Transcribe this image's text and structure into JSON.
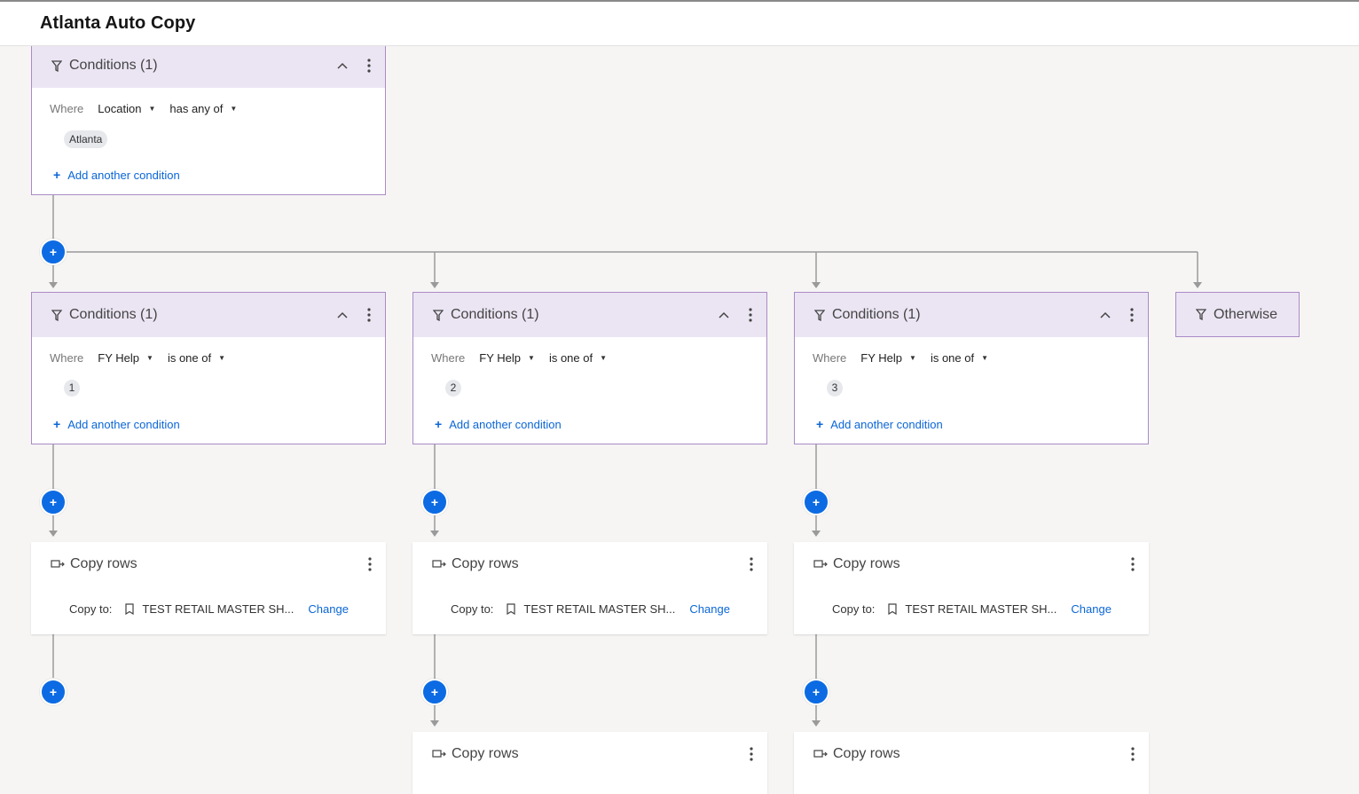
{
  "header": {
    "title": "Atlanta Auto Copy"
  },
  "root_condition": {
    "label": "Conditions (1)",
    "where_label": "Where",
    "field": "Location",
    "operator": "has any of",
    "value": "Atlanta",
    "add_label": "Add another condition"
  },
  "branches": [
    {
      "label": "Conditions (1)",
      "where_label": "Where",
      "field": "FY Help",
      "operator": "is one of",
      "value": "1",
      "add_label": "Add another condition"
    },
    {
      "label": "Conditions (1)",
      "where_label": "Where",
      "field": "FY Help",
      "operator": "is one of",
      "value": "2",
      "add_label": "Add another condition"
    },
    {
      "label": "Conditions (1)",
      "where_label": "Where",
      "field": "FY Help",
      "operator": "is one of",
      "value": "3",
      "add_label": "Add another condition"
    }
  ],
  "otherwise": {
    "label": "Otherwise"
  },
  "copy_actions": [
    {
      "label": "Copy rows",
      "copy_to_label": "Copy to:",
      "sheet": "TEST RETAIL MASTER SH...",
      "change_label": "Change"
    },
    {
      "label": "Copy rows",
      "copy_to_label": "Copy to:",
      "sheet": "TEST RETAIL MASTER SH...",
      "change_label": "Change"
    },
    {
      "label": "Copy rows",
      "copy_to_label": "Copy to:",
      "sheet": "TEST RETAIL MASTER SH...",
      "change_label": "Change"
    }
  ],
  "copy_actions_second": [
    {
      "label": "Copy rows"
    },
    {
      "label": "Copy rows"
    }
  ],
  "add_button_symbol": "+",
  "colors": {
    "accent": "#0c6be3",
    "link": "#0b66d6",
    "condition_header": "#ebe5f3",
    "condition_border": "#a98bc6",
    "connector": "#9a9a9a"
  }
}
